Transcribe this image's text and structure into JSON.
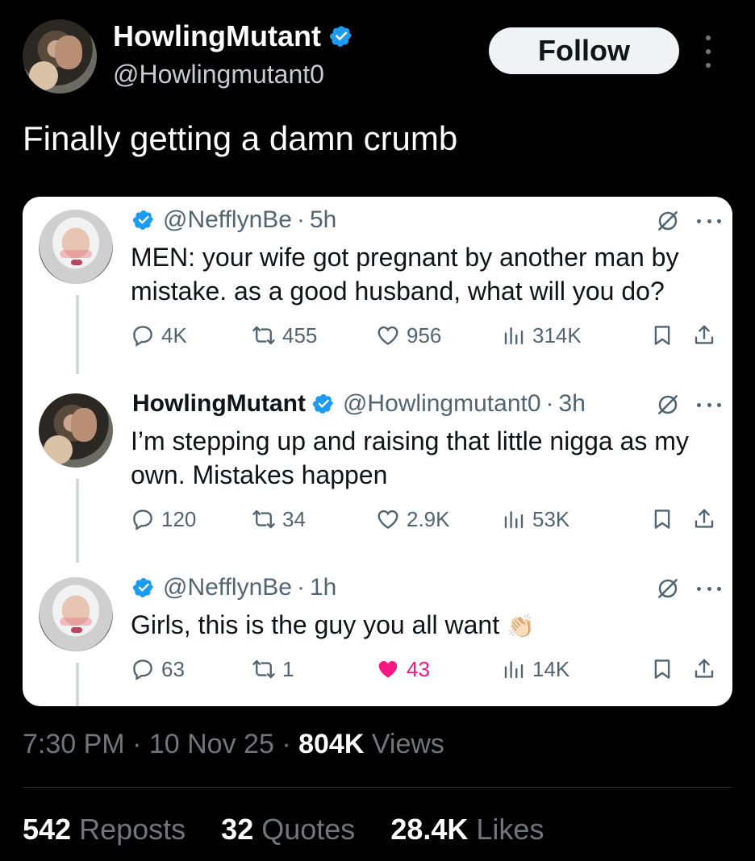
{
  "author": {
    "name": "HowlingMutant",
    "handle": "@Howlingmutant0",
    "follow_label": "Follow"
  },
  "tweet": {
    "text": "Finally getting a damn crumb",
    "time": "7:30 PM",
    "date": "10 Nov 25",
    "views_count": "804K",
    "views_label": "Views",
    "reposts_count": "542",
    "reposts_label": "Reposts",
    "quotes_count": "32",
    "quotes_label": "Quotes",
    "likes_count": "28.4K",
    "likes_label": "Likes"
  },
  "quoted_thread": [
    {
      "name": "",
      "handle": "@NefflynBe",
      "time": "5h",
      "text": "MEN: your wife got pregnant by another man by mistake. as a good husband, what will you do?",
      "replies": "4K",
      "reposts": "455",
      "likes": "956",
      "views": "314K",
      "liked": false
    },
    {
      "name": "HowlingMutant",
      "handle": "@Howlingmutant0",
      "time": "3h",
      "text": "I’m stepping up and raising that little nigga as my own.  Mistakes happen",
      "replies": "120",
      "reposts": "34",
      "likes": "2.9K",
      "views": "53K",
      "liked": false
    },
    {
      "name": "",
      "handle": "@NefflynBe",
      "time": "1h",
      "text": "Girls, this is the guy you all want",
      "emoji": "👏🏻",
      "replies": "63",
      "reposts": "1",
      "likes": "43",
      "views": "14K",
      "liked": true
    }
  ],
  "colors": {
    "background": "#000000",
    "verified_blue": "#1d9bf0",
    "like_pink": "#f91880",
    "muted_text": "#71767b",
    "card_bg": "#ffffff"
  },
  "icons": [
    "verified-badge-icon",
    "more-icon",
    "grok-icon",
    "reply-icon",
    "repost-icon",
    "like-icon",
    "views-icon",
    "bookmark-icon",
    "share-icon"
  ]
}
